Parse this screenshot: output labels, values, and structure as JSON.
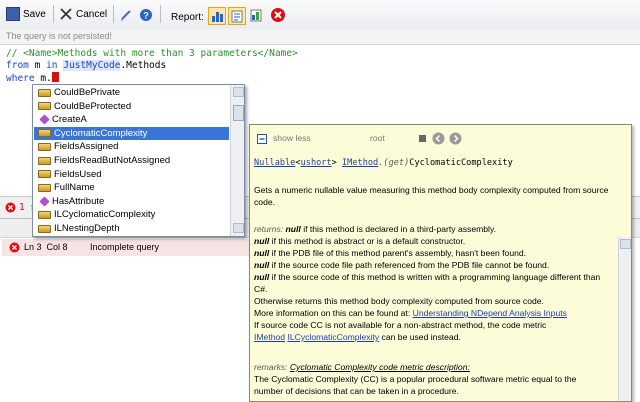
{
  "toolbar": {
    "save_label": "Save",
    "cancel_label": "Cancel",
    "report_label": "Report:"
  },
  "status": {
    "persist_msg": "The query is not persisted!"
  },
  "code": {
    "line1_prefix": "// <Name>",
    "line1_name": "Methods with more than 3 parameters",
    "line1_suffix": "</Name>",
    "line2_from": "from",
    "line2_var": " m ",
    "line2_in": "in",
    "line2_type": "JustMyCode",
    "line2_rest": ".Methods",
    "line3_where": "where",
    "line3_rest": " m."
  },
  "errors": {
    "count_text": "1 s",
    "row_location": "Ln 3  Col 8",
    "row_message": "Incomplete query"
  },
  "completion": {
    "items": [
      {
        "label": "CouldBePrivate",
        "kind": "property"
      },
      {
        "label": "CouldBeProtected",
        "kind": "property"
      },
      {
        "label": "CreateA",
        "kind": "method"
      },
      {
        "label": "CyclomaticComplexity",
        "kind": "property"
      },
      {
        "label": "FieldsAssigned",
        "kind": "property"
      },
      {
        "label": "FieldsReadButNotAssigned",
        "kind": "property"
      },
      {
        "label": "FieldsUsed",
        "kind": "property"
      },
      {
        "label": "FullName",
        "kind": "property"
      },
      {
        "label": "HasAttribute",
        "kind": "method"
      },
      {
        "label": "ILCyclomaticComplexity",
        "kind": "property"
      },
      {
        "label": "ILNestingDepth",
        "kind": "property"
      }
    ],
    "selected": 3
  },
  "doc": {
    "show_less": "show less",
    "root": "root",
    "sig_nullable": "Nullable",
    "sig_lt": "<",
    "sig_ushort": "ushort",
    "sig_gt": "> ",
    "sig_imethod": "IMethod",
    "sig_get": ".(get)",
    "sig_name": "CyclomaticComplexity",
    "desc1": "Gets a numeric nullable value measuring this method body complexity computed from source",
    "desc2": "code.",
    "returns_label": "returns:",
    "null_word": "null",
    "r1": " if this method is declared in a third-party assembly.",
    "r2": " if this method is abstract or is a default constructor.",
    "r3": " if the PDB file of this method parent's assembly, hasn't been found.",
    "r4": " if the source code file path referenced from the PDB file cannot be found.",
    "r5": " if the source code of this method is written with a programming language different than",
    "r5b": "C#.",
    "r6": "Otherwise returns this method body complexity computed from source code.",
    "more_info": "More information on this can be found at: ",
    "more_link": "Understanding NDepend Analysis Inputs",
    "cc_na": "If source code CC is not available for a non-abstract method, the code metric",
    "imethod_link": "IMethod",
    "ilcc_link": "ILCyclomaticComplexity",
    "used_instead": " can be used instead.",
    "remarks_label": "remarks:",
    "remarks_title": "Cyclomatic Complexity code metric description:",
    "rem1": "The Cyclomatic Complexity (CC) is a popular procedural software metric equal to the",
    "rem2": "number of decisions that can be taken in a procedure."
  },
  "colors": {
    "selection": "#3875d7",
    "doc_bg": "#fcfcd9",
    "property_icon": "#c89a2e",
    "method_icon": "#b04fc8",
    "error": "#d81010"
  }
}
